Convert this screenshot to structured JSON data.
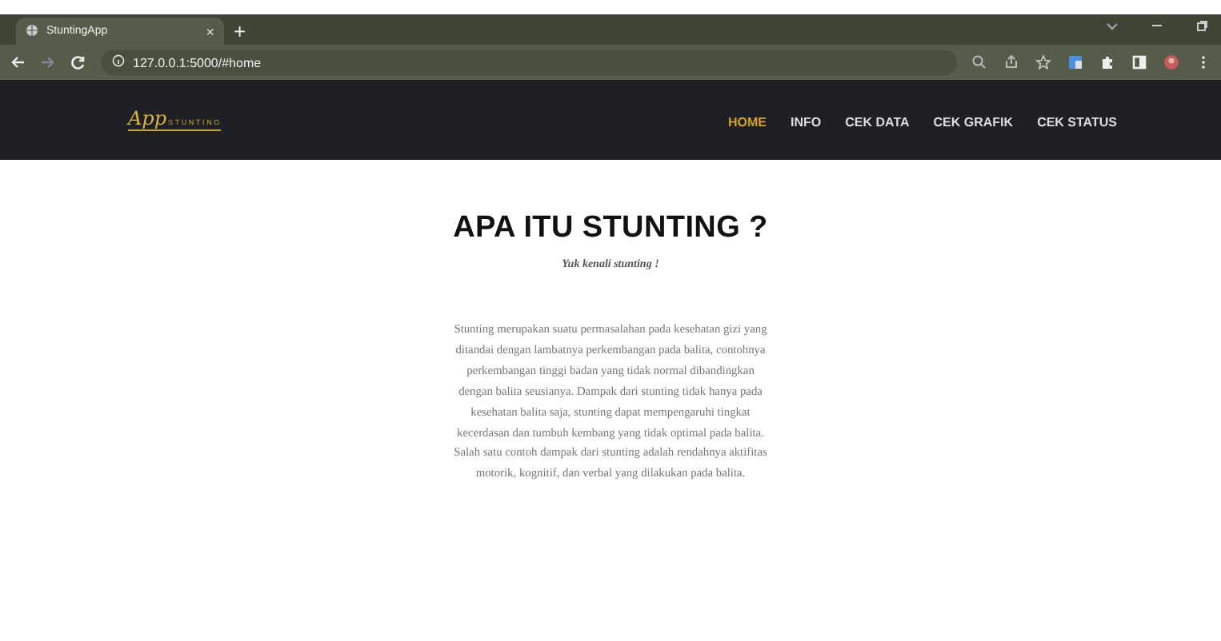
{
  "browser": {
    "tab_title": "StuntingApp",
    "tab_close": "×",
    "new_tab": "+",
    "address": "127.0.0.1:5000/#home"
  },
  "navbar": {
    "logo_script": "App",
    "logo_sub": "STUNTING",
    "items": [
      {
        "label": "HOME",
        "selected": true
      },
      {
        "label": "INFO",
        "selected": false
      },
      {
        "label": "CEK DATA",
        "selected": false
      },
      {
        "label": "CEK GRAFIK",
        "selected": false
      },
      {
        "label": "CEK STATUS",
        "selected": false
      }
    ]
  },
  "content": {
    "title": "APA ITU STUNTING ?",
    "subtitle": "Yuk kenali stunting !",
    "paragraph": "Stunting merupakan suatu permasalahan pada kesehatan gizi yang ditandai dengan lambatnya perkembangan pada balita, contohnya perkembangan tinggi badan yang tidak normal dibandingkan dengan balita seusianya. Dampak dari stunting tidak hanya pada kesehatan balita saja, stunting dapat mempengaruhi tingkat kecerdasan dan tumbuh kembang yang tidak optimal pada balita. Salah satu contoh dampak dari stunting adalah rendahnya aktifitas motorik, kognitif, dan verbal yang dilakukan pada balita."
  }
}
